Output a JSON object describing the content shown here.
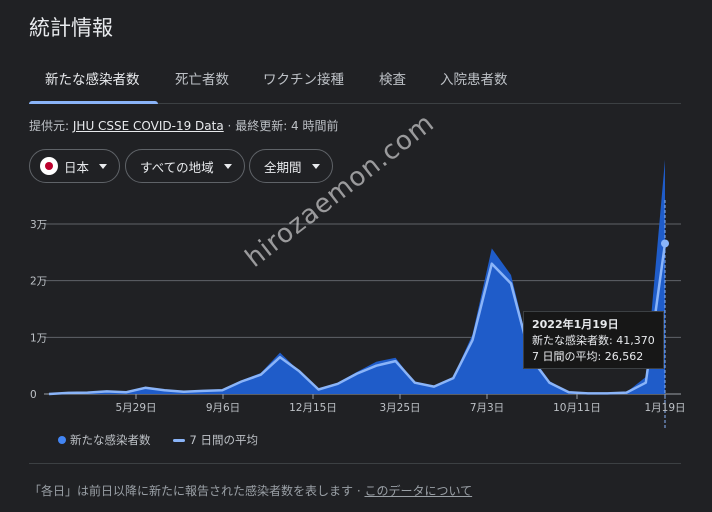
{
  "title": "統計情報",
  "tabs": [
    {
      "label": "新たな感染者数"
    },
    {
      "label": "死亡者数"
    },
    {
      "label": "ワクチン接種"
    },
    {
      "label": "検査"
    },
    {
      "label": "入院患者数"
    }
  ],
  "source": {
    "prefix": "提供元:",
    "link": "JHU CSSE COVID-19 Data",
    "sep": "·",
    "updated": "最終更新: 4 時間前"
  },
  "filters": {
    "country": "日本",
    "region": "すべての地域",
    "period": "全期間"
  },
  "colors": {
    "area": "#1f5cc9",
    "avg_line": "#8ab4f8",
    "tab_active": "#8ab4f8"
  },
  "tooltip": {
    "date": "2022年1月19日",
    "new_cases": "新たな感染者数: 41,370",
    "avg": "7 日間の平均: 26,562"
  },
  "legend": {
    "daily": "新たな感染者数",
    "avg": "7 日間の平均"
  },
  "footer": {
    "note": "「各日」は前日以降に新たに報告された感染者数を表します ·",
    "link": "このデータについて"
  },
  "watermark": "hirozaemon.com",
  "chart_data": {
    "type": "area",
    "y_ticks": [
      "0",
      "1万",
      "2万",
      "3万"
    ],
    "ylim": [
      0,
      30000
    ],
    "x_ticks": [
      "5月29日",
      "9月6日",
      "12月15日",
      "3月25日",
      "7月3日",
      "10月11日",
      "1月19日"
    ],
    "series": [
      {
        "name": "新たな感染者数",
        "values": [
          0,
          200,
          300,
          500,
          300,
          1200,
          700,
          400,
          600,
          700,
          2400,
          3700,
          7300,
          4000,
          800,
          2000,
          3900,
          5700,
          6400,
          2000,
          1400,
          3000,
          10500,
          25700,
          21000,
          7000,
          2300,
          300,
          100,
          100,
          300,
          3000,
          41370
        ]
      },
      {
        "name": "7 日間の平均",
        "values": [
          0,
          200,
          250,
          450,
          300,
          1100,
          650,
          400,
          550,
          650,
          2200,
          3400,
          6500,
          4000,
          800,
          1800,
          3600,
          5000,
          5800,
          2000,
          1300,
          2800,
          9500,
          23000,
          19500,
          6500,
          2000,
          300,
          100,
          100,
          250,
          2000,
          26562
        ]
      }
    ]
  }
}
